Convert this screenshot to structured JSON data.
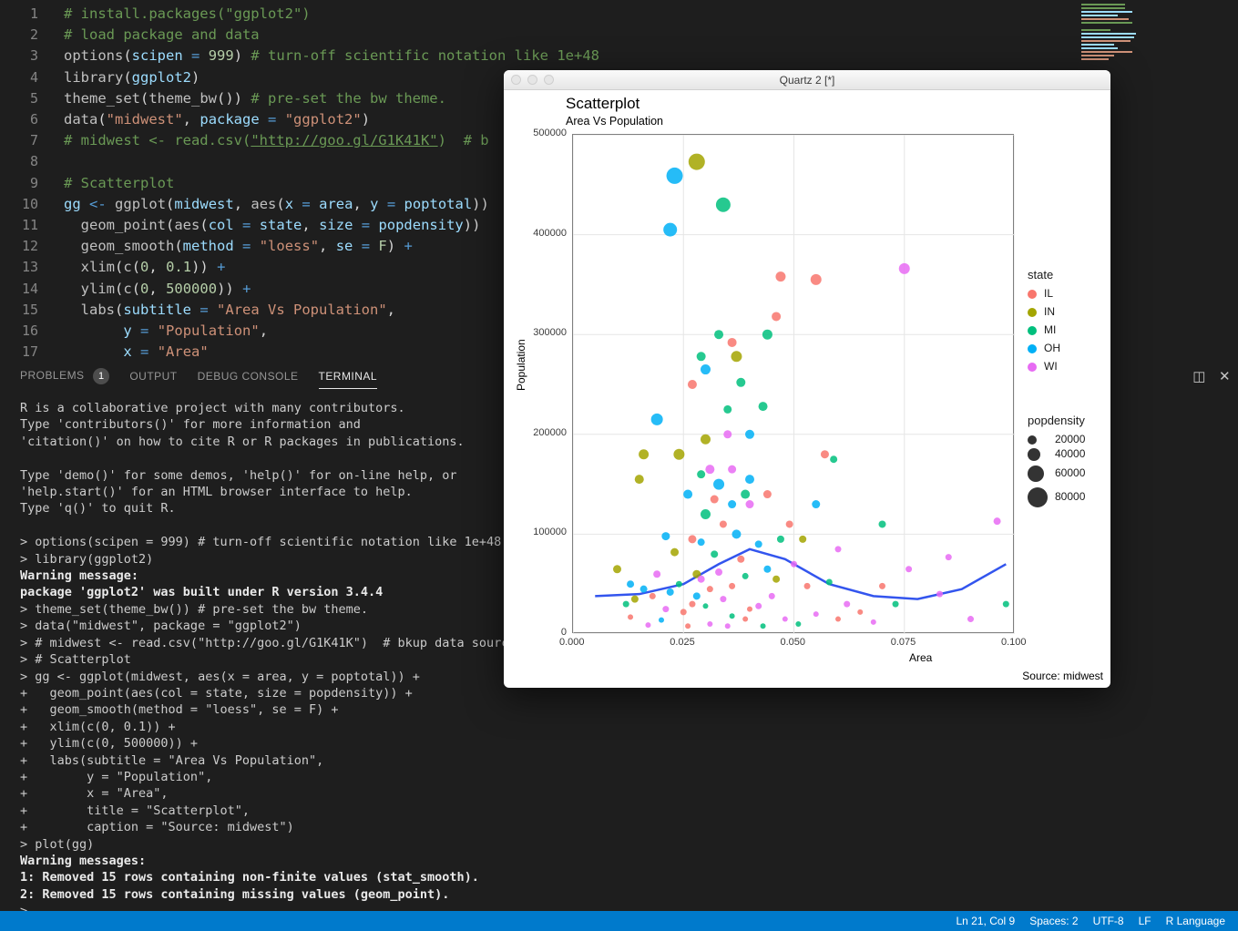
{
  "editor": {
    "lines": [
      {
        "n": 1,
        "html": "<span class='cmt'># install.packages(\"ggplot2\")</span>"
      },
      {
        "n": 2,
        "html": "<span class='cmt'># load package and data</span>"
      },
      {
        "n": 3,
        "html": "<span class='fn'>options</span><span class='par'>(</span><span class='id'>scipen</span> <span class='op'>=</span> <span class='num'>999</span><span class='par'>)</span> <span class='cmt'># turn-off scientific notation like 1e+48</span>"
      },
      {
        "n": 4,
        "html": "<span class='fn'>library</span><span class='par'>(</span><span class='id'>ggplot2</span><span class='par'>)</span>"
      },
      {
        "n": 5,
        "html": "<span class='fn'>theme_set</span><span class='par'>(</span><span class='fn'>theme_bw</span><span class='par'>())</span> <span class='cmt'># pre-set the bw theme.</span>"
      },
      {
        "n": 6,
        "html": "<span class='fn'>data</span><span class='par'>(</span><span class='str'>\"midwest\"</span><span class='par'>,</span> <span class='id'>package</span> <span class='op'>=</span> <span class='str'>\"ggplot2\"</span><span class='par'>)</span>"
      },
      {
        "n": 7,
        "html": "<span class='cmt'># midwest &lt;- read.csv(</span><span class='cmt url'>\"http://goo.gl/G1K41K\"</span><span class='cmt'>)  # b</span>"
      },
      {
        "n": 8,
        "html": ""
      },
      {
        "n": 9,
        "html": "<span class='cmt'># Scatterplot</span>"
      },
      {
        "n": 10,
        "html": "<span class='id'>gg</span> <span class='op'>&lt;-</span> <span class='fn'>ggplot</span><span class='par'>(</span><span class='id'>midwest</span><span class='par'>,</span> <span class='fn'>aes</span><span class='par'>(</span><span class='id'>x</span> <span class='op'>=</span> <span class='id'>area</span><span class='par'>,</span> <span class='id'>y</span> <span class='op'>=</span> <span class='id'>poptotal</span><span class='par'>))</span>"
      },
      {
        "n": 11,
        "html": "  <span class='fn'>geom_point</span><span class='par'>(</span><span class='fn'>aes</span><span class='par'>(</span><span class='id'>col</span> <span class='op'>=</span> <span class='id'>state</span><span class='par'>,</span> <span class='id'>size</span> <span class='op'>=</span> <span class='id'>popdensity</span><span class='par'>))</span>"
      },
      {
        "n": 12,
        "html": "  <span class='fn'>geom_smooth</span><span class='par'>(</span><span class='id'>method</span> <span class='op'>=</span> <span class='str'>\"loess\"</span><span class='par'>,</span> <span class='id'>se</span> <span class='op'>=</span> <span class='num'>F</span><span class='par'>)</span> <span class='op'>+</span>"
      },
      {
        "n": 13,
        "html": "  <span class='fn'>xlim</span><span class='par'>(</span><span class='fn'>c</span><span class='par'>(</span><span class='num'>0</span><span class='par'>,</span> <span class='num'>0.1</span><span class='par'>))</span> <span class='op'>+</span>"
      },
      {
        "n": 14,
        "html": "  <span class='fn'>ylim</span><span class='par'>(</span><span class='fn'>c</span><span class='par'>(</span><span class='num'>0</span><span class='par'>,</span> <span class='num'>500000</span><span class='par'>))</span> <span class='op'>+</span>"
      },
      {
        "n": 15,
        "html": "  <span class='fn'>labs</span><span class='par'>(</span><span class='id'>subtitle</span> <span class='op'>=</span> <span class='str'>\"Area Vs Population\"</span><span class='par'>,</span>"
      },
      {
        "n": 16,
        "html": "       <span class='id'>y</span> <span class='op'>=</span> <span class='str'>\"Population\"</span><span class='par'>,</span>"
      },
      {
        "n": 17,
        "html": "       <span class='id'>x</span> <span class='op'>=</span> <span class='str'>\"Area\"</span>"
      }
    ]
  },
  "panel": {
    "tabs": {
      "problems": "PROBLEMS",
      "problems_count": "1",
      "output": "OUTPUT",
      "debug": "DEBUG CONSOLE",
      "terminal": "TERMINAL"
    }
  },
  "terminal_text": "R is a collaborative project with many contributors.\nType 'contributors()' for more information and\n'citation()' on how to cite R or R packages in publications.\n\nType 'demo()' for some demos, 'help()' for on-line help, or\n'help.start()' for an HTML browser interface to help.\nType 'q()' to quit R.\n\n> options(scipen = 999) # turn-off scientific notation like 1e+48\n> library(ggplot2)\n<b>Warning message:</b>\n<b>package 'ggplot2' was built under R version 3.4.4</b>\n> theme_set(theme_bw()) # pre-set the bw theme.\n> data(\"midwest\", package = \"ggplot2\")\n> # midwest <- read.csv(\"http://goo.gl/G1K41K\")  # bkup data source\n> # Scatterplot\n> gg <- ggplot(midwest, aes(x = area, y = poptotal)) +\n+   geom_point(aes(col = state, size = popdensity)) +\n+   geom_smooth(method = \"loess\", se = F) +\n+   xlim(c(0, 0.1)) +\n+   ylim(c(0, 500000)) +\n+   labs(subtitle = \"Area Vs Population\",\n+        y = \"Population\",\n+        x = \"Area\",\n+        title = \"Scatterplot\",\n+        caption = \"Source: midwest\")\n> plot(gg)\n<b>Warning messages:</b>\n<b>1: Removed 15 rows containing non-finite values (stat_smooth).</b>\n<b>2: Removed 15 rows containing missing values (geom_point).</b>\n> ",
  "statusbar": {
    "lncol": "Ln 21, Col 9",
    "spaces": "Spaces: 2",
    "enc": "UTF-8",
    "eol": "LF",
    "lang": "R Language"
  },
  "quartz": {
    "title": "Quartz 2 [*]"
  },
  "chart_data": {
    "type": "scatter",
    "title": "Scatterplot",
    "subtitle": "Area Vs Population",
    "caption": "Source: midwest",
    "xlabel": "Area",
    "ylabel": "Population",
    "xlim": [
      0,
      0.1
    ],
    "ylim": [
      0,
      500000
    ],
    "xticks": [
      0.0,
      0.025,
      0.05,
      0.075,
      0.1
    ],
    "yticks": [
      0,
      100000,
      200000,
      300000,
      400000,
      500000
    ],
    "legend_color": {
      "title": "state",
      "items": [
        {
          "label": "IL",
          "color": "#F8766D"
        },
        {
          "label": "IN",
          "color": "#A3A500"
        },
        {
          "label": "MI",
          "color": "#00BF7D"
        },
        {
          "label": "OH",
          "color": "#00B0F6"
        },
        {
          "label": "WI",
          "color": "#E76BF3"
        }
      ]
    },
    "legend_size": {
      "title": "popdensity",
      "items": [
        {
          "label": "20000",
          "r": 5
        },
        {
          "label": "40000",
          "r": 7
        },
        {
          "label": "60000",
          "r": 9
        },
        {
          "label": "80000",
          "r": 11
        }
      ]
    },
    "smooth_line": [
      {
        "x": 0.005,
        "y": 38000
      },
      {
        "x": 0.015,
        "y": 40000
      },
      {
        "x": 0.025,
        "y": 50000
      },
      {
        "x": 0.033,
        "y": 70000
      },
      {
        "x": 0.04,
        "y": 85000
      },
      {
        "x": 0.048,
        "y": 75000
      },
      {
        "x": 0.058,
        "y": 50000
      },
      {
        "x": 0.068,
        "y": 38000
      },
      {
        "x": 0.078,
        "y": 35000
      },
      {
        "x": 0.088,
        "y": 45000
      },
      {
        "x": 0.098,
        "y": 70000
      }
    ],
    "points": [
      {
        "x": 0.028,
        "y": 473000,
        "state": "IN",
        "size": 9
      },
      {
        "x": 0.023,
        "y": 459000,
        "state": "OH",
        "size": 9
      },
      {
        "x": 0.034,
        "y": 430000,
        "state": "MI",
        "size": 8
      },
      {
        "x": 0.022,
        "y": 405000,
        "state": "OH",
        "size": 7.5
      },
      {
        "x": 0.019,
        "y": 215000,
        "state": "OH",
        "size": 6.5
      },
      {
        "x": 0.075,
        "y": 366000,
        "state": "WI",
        "size": 6
      },
      {
        "x": 0.055,
        "y": 355000,
        "state": "IL",
        "size": 6
      },
      {
        "x": 0.046,
        "y": 318000,
        "state": "IL",
        "size": 5
      },
      {
        "x": 0.047,
        "y": 358000,
        "state": "IL",
        "size": 5.5
      },
      {
        "x": 0.044,
        "y": 300000,
        "state": "MI",
        "size": 5.5
      },
      {
        "x": 0.036,
        "y": 292000,
        "state": "IL",
        "size": 5
      },
      {
        "x": 0.029,
        "y": 278000,
        "state": "MI",
        "size": 5
      },
      {
        "x": 0.03,
        "y": 265000,
        "state": "OH",
        "size": 5.5
      },
      {
        "x": 0.033,
        "y": 300000,
        "state": "MI",
        "size": 5
      },
      {
        "x": 0.027,
        "y": 250000,
        "state": "IL",
        "size": 5
      },
      {
        "x": 0.037,
        "y": 278000,
        "state": "IN",
        "size": 6
      },
      {
        "x": 0.038,
        "y": 252000,
        "state": "MI",
        "size": 5
      },
      {
        "x": 0.043,
        "y": 228000,
        "state": "MI",
        "size": 5
      },
      {
        "x": 0.035,
        "y": 225000,
        "state": "MI",
        "size": 4.5
      },
      {
        "x": 0.024,
        "y": 180000,
        "state": "IN",
        "size": 6
      },
      {
        "x": 0.015,
        "y": 155000,
        "state": "IN",
        "size": 5
      },
      {
        "x": 0.016,
        "y": 180000,
        "state": "IN",
        "size": 5.5
      },
      {
        "x": 0.031,
        "y": 165000,
        "state": "WI",
        "size": 5
      },
      {
        "x": 0.033,
        "y": 150000,
        "state": "OH",
        "size": 6
      },
      {
        "x": 0.03,
        "y": 195000,
        "state": "IN",
        "size": 5.5
      },
      {
        "x": 0.035,
        "y": 200000,
        "state": "WI",
        "size": 4.5
      },
      {
        "x": 0.04,
        "y": 155000,
        "state": "OH",
        "size": 5
      },
      {
        "x": 0.039,
        "y": 140000,
        "state": "MI",
        "size": 5
      },
      {
        "x": 0.044,
        "y": 140000,
        "state": "IL",
        "size": 4.5
      },
      {
        "x": 0.057,
        "y": 180000,
        "state": "IL",
        "size": 4.5
      },
      {
        "x": 0.059,
        "y": 175000,
        "state": "MI",
        "size": 4
      },
      {
        "x": 0.04,
        "y": 130000,
        "state": "WI",
        "size": 4.5
      },
      {
        "x": 0.036,
        "y": 130000,
        "state": "OH",
        "size": 4.5
      },
      {
        "x": 0.03,
        "y": 120000,
        "state": "MI",
        "size": 5.5
      },
      {
        "x": 0.034,
        "y": 110000,
        "state": "IL",
        "size": 4
      },
      {
        "x": 0.07,
        "y": 110000,
        "state": "MI",
        "size": 4
      },
      {
        "x": 0.096,
        "y": 113000,
        "state": "WI",
        "size": 4
      },
      {
        "x": 0.076,
        "y": 65000,
        "state": "WI",
        "size": 3.5
      },
      {
        "x": 0.083,
        "y": 40000,
        "state": "WI",
        "size": 3.5
      },
      {
        "x": 0.098,
        "y": 30000,
        "state": "MI",
        "size": 3.5
      },
      {
        "x": 0.09,
        "y": 15000,
        "state": "WI",
        "size": 3.5
      },
      {
        "x": 0.073,
        "y": 30000,
        "state": "MI",
        "size": 3.5
      },
      {
        "x": 0.085,
        "y": 77000,
        "state": "WI",
        "size": 3.5
      },
      {
        "x": 0.01,
        "y": 65000,
        "state": "IN",
        "size": 4.5
      },
      {
        "x": 0.014,
        "y": 35000,
        "state": "IN",
        "size": 4
      },
      {
        "x": 0.018,
        "y": 38000,
        "state": "IL",
        "size": 3.5
      },
      {
        "x": 0.022,
        "y": 42000,
        "state": "OH",
        "size": 4
      },
      {
        "x": 0.027,
        "y": 95000,
        "state": "IL",
        "size": 4.5
      },
      {
        "x": 0.029,
        "y": 92000,
        "state": "OH",
        "size": 4
      },
      {
        "x": 0.028,
        "y": 60000,
        "state": "IN",
        "size": 4.5
      },
      {
        "x": 0.032,
        "y": 80000,
        "state": "MI",
        "size": 4
      },
      {
        "x": 0.033,
        "y": 62000,
        "state": "WI",
        "size": 4
      },
      {
        "x": 0.037,
        "y": 100000,
        "state": "OH",
        "size": 5
      },
      {
        "x": 0.038,
        "y": 75000,
        "state": "IL",
        "size": 4
      },
      {
        "x": 0.042,
        "y": 90000,
        "state": "OH",
        "size": 4
      },
      {
        "x": 0.047,
        "y": 95000,
        "state": "MI",
        "size": 4
      },
      {
        "x": 0.05,
        "y": 70000,
        "state": "WI",
        "size": 3.5
      },
      {
        "x": 0.053,
        "y": 48000,
        "state": "IL",
        "size": 3.5
      },
      {
        "x": 0.058,
        "y": 52000,
        "state": "MI",
        "size": 3.5
      },
      {
        "x": 0.062,
        "y": 30000,
        "state": "WI",
        "size": 3.5
      },
      {
        "x": 0.065,
        "y": 22000,
        "state": "IL",
        "size": 3
      },
      {
        "x": 0.045,
        "y": 38000,
        "state": "WI",
        "size": 3.5
      },
      {
        "x": 0.04,
        "y": 25000,
        "state": "IL",
        "size": 3
      },
      {
        "x": 0.036,
        "y": 18000,
        "state": "MI",
        "size": 3
      },
      {
        "x": 0.031,
        "y": 10000,
        "state": "WI",
        "size": 3
      },
      {
        "x": 0.025,
        "y": 22000,
        "state": "IL",
        "size": 3.5
      },
      {
        "x": 0.02,
        "y": 14000,
        "state": "OH",
        "size": 3
      },
      {
        "x": 0.017,
        "y": 9000,
        "state": "WI",
        "size": 3
      },
      {
        "x": 0.013,
        "y": 17000,
        "state": "IL",
        "size": 3
      },
      {
        "x": 0.012,
        "y": 30000,
        "state": "MI",
        "size": 3.5
      },
      {
        "x": 0.048,
        "y": 15000,
        "state": "WI",
        "size": 3
      },
      {
        "x": 0.051,
        "y": 10000,
        "state": "MI",
        "size": 3
      },
      {
        "x": 0.055,
        "y": 20000,
        "state": "WI",
        "size": 3
      },
      {
        "x": 0.046,
        "y": 55000,
        "state": "IN",
        "size": 4
      },
      {
        "x": 0.028,
        "y": 38000,
        "state": "OH",
        "size": 4
      },
      {
        "x": 0.023,
        "y": 82000,
        "state": "IN",
        "size": 4.5
      },
      {
        "x": 0.019,
        "y": 60000,
        "state": "WI",
        "size": 4
      },
      {
        "x": 0.021,
        "y": 98000,
        "state": "OH",
        "size": 4.5
      },
      {
        "x": 0.031,
        "y": 45000,
        "state": "IL",
        "size": 3.5
      },
      {
        "x": 0.034,
        "y": 35000,
        "state": "WI",
        "size": 3.5
      },
      {
        "x": 0.036,
        "y": 48000,
        "state": "IL",
        "size": 3.5
      },
      {
        "x": 0.039,
        "y": 58000,
        "state": "MI",
        "size": 3.5
      },
      {
        "x": 0.042,
        "y": 28000,
        "state": "WI",
        "size": 3.5
      },
      {
        "x": 0.044,
        "y": 65000,
        "state": "OH",
        "size": 4
      },
      {
        "x": 0.029,
        "y": 55000,
        "state": "WI",
        "size": 4
      },
      {
        "x": 0.024,
        "y": 50000,
        "state": "MI",
        "size": 3.5
      },
      {
        "x": 0.027,
        "y": 30000,
        "state": "IL",
        "size": 3.5
      },
      {
        "x": 0.021,
        "y": 25000,
        "state": "WI",
        "size": 3.5
      },
      {
        "x": 0.016,
        "y": 45000,
        "state": "OH",
        "size": 4
      },
      {
        "x": 0.049,
        "y": 110000,
        "state": "IL",
        "size": 4
      },
      {
        "x": 0.052,
        "y": 95000,
        "state": "IN",
        "size": 4
      },
      {
        "x": 0.055,
        "y": 130000,
        "state": "OH",
        "size": 4.5
      },
      {
        "x": 0.06,
        "y": 85000,
        "state": "WI",
        "size": 3.5
      },
      {
        "x": 0.026,
        "y": 140000,
        "state": "OH",
        "size": 5
      },
      {
        "x": 0.029,
        "y": 160000,
        "state": "MI",
        "size": 4.5
      },
      {
        "x": 0.032,
        "y": 135000,
        "state": "IL",
        "size": 4.5
      },
      {
        "x": 0.036,
        "y": 165000,
        "state": "WI",
        "size": 4.5
      },
      {
        "x": 0.04,
        "y": 200000,
        "state": "OH",
        "size": 5
      },
      {
        "x": 0.026,
        "y": 8000,
        "state": "IL",
        "size": 3
      },
      {
        "x": 0.03,
        "y": 28000,
        "state": "MI",
        "size": 3
      },
      {
        "x": 0.035,
        "y": 8000,
        "state": "WI",
        "size": 3
      },
      {
        "x": 0.039,
        "y": 15000,
        "state": "IL",
        "size": 3
      },
      {
        "x": 0.043,
        "y": 8000,
        "state": "MI",
        "size": 3
      },
      {
        "x": 0.06,
        "y": 15000,
        "state": "IL",
        "size": 3
      },
      {
        "x": 0.068,
        "y": 12000,
        "state": "WI",
        "size": 3
      },
      {
        "x": 0.07,
        "y": 48000,
        "state": "IL",
        "size": 3.5
      },
      {
        "x": 0.013,
        "y": 50000,
        "state": "OH",
        "size": 4
      }
    ]
  }
}
